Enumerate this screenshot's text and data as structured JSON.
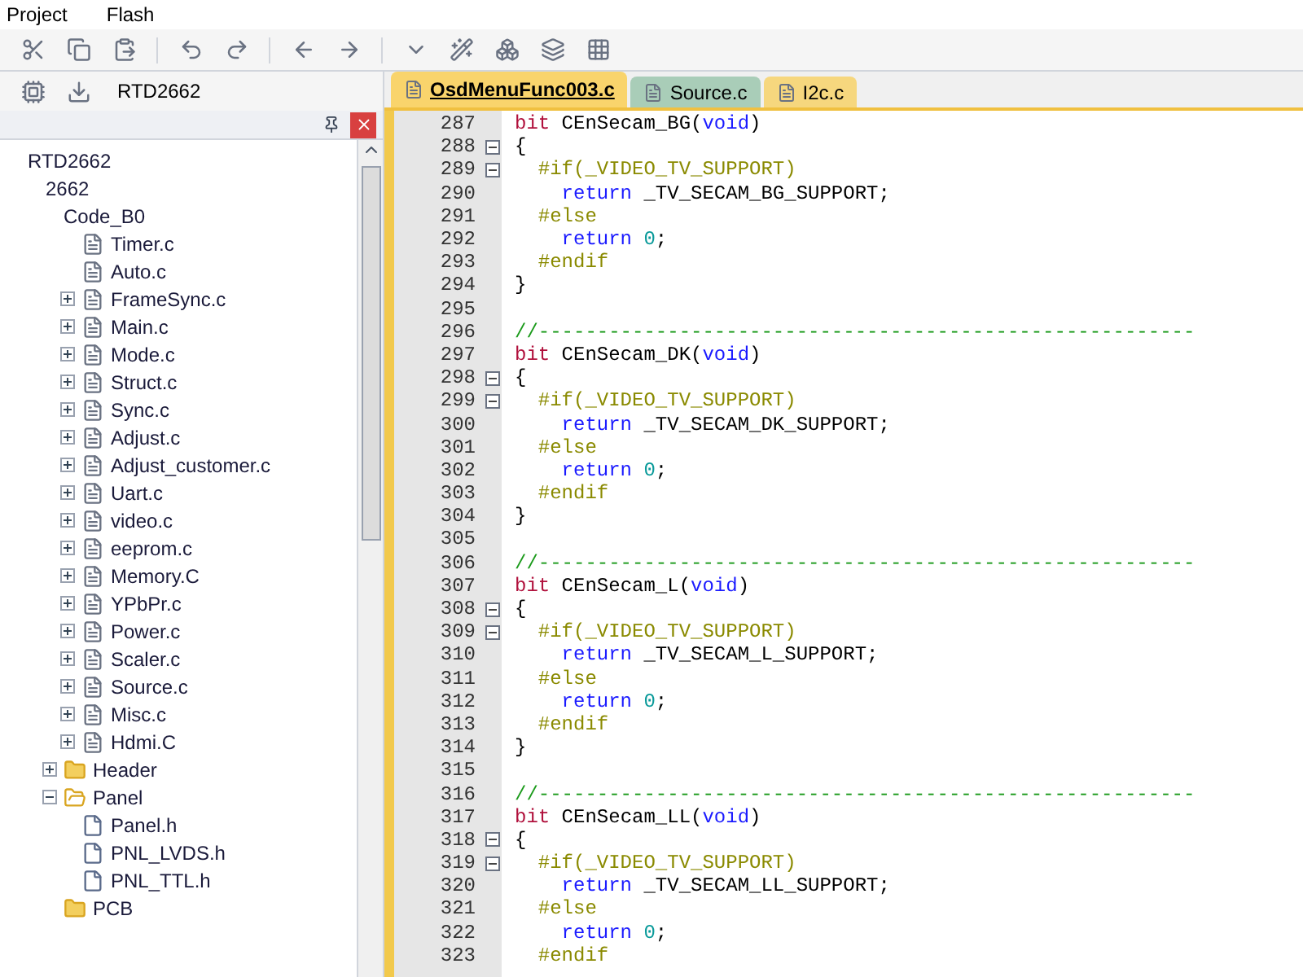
{
  "menu": [
    "Project",
    "Flash"
  ],
  "target": "RTD2662",
  "tabs": [
    {
      "label": "OsdMenuFunc003.c",
      "selected": true,
      "color": "#f9d46c"
    },
    {
      "label": "Source.c",
      "selected": false,
      "color": "#a9cdb8"
    },
    {
      "label": "I2c.c",
      "selected": false,
      "color": "#f6d77e"
    }
  ],
  "tree": [
    {
      "label": "RTD2662",
      "children": [
        {
          "label": "2662",
          "children": [
            {
              "label": "Code_B0",
              "children": [
                {
                  "label": "Timer.c",
                  "kind": "file"
                },
                {
                  "label": "Auto.c",
                  "kind": "file"
                },
                {
                  "label": "FrameSync.c",
                  "kind": "file",
                  "expanded": false
                },
                {
                  "label": "Main.c",
                  "kind": "file",
                  "expanded": false
                },
                {
                  "label": "Mode.c",
                  "kind": "file",
                  "expanded": false
                },
                {
                  "label": "Struct.c",
                  "kind": "file",
                  "expanded": false
                },
                {
                  "label": "Sync.c",
                  "kind": "file",
                  "expanded": false
                },
                {
                  "label": "Adjust.c",
                  "kind": "file",
                  "expanded": false
                },
                {
                  "label": "Adjust_customer.c",
                  "kind": "file",
                  "expanded": false
                },
                {
                  "label": "Uart.c",
                  "kind": "file",
                  "expanded": false
                },
                {
                  "label": "video.c",
                  "kind": "file",
                  "expanded": false
                },
                {
                  "label": "eeprom.c",
                  "kind": "file",
                  "expanded": false
                },
                {
                  "label": "Memory.C",
                  "kind": "file",
                  "expanded": false
                },
                {
                  "label": "YPbPr.c",
                  "kind": "file",
                  "expanded": false
                },
                {
                  "label": "Power.c",
                  "kind": "file",
                  "expanded": false
                },
                {
                  "label": "Scaler.c",
                  "kind": "file",
                  "expanded": false
                },
                {
                  "label": "Source.c",
                  "kind": "file",
                  "expanded": false
                },
                {
                  "label": "Misc.c",
                  "kind": "file",
                  "expanded": false
                },
                {
                  "label": "Hdmi.C",
                  "kind": "file",
                  "expanded": false
                }
              ]
            },
            {
              "label": "Header",
              "kind": "folder",
              "expanded": false
            },
            {
              "label": "Panel",
              "kind": "folder",
              "expanded": true,
              "children": [
                {
                  "label": "Panel.h",
                  "kind": "header"
                },
                {
                  "label": "PNL_LVDS.h",
                  "kind": "header"
                },
                {
                  "label": "PNL_TTL.h",
                  "kind": "header"
                }
              ]
            },
            {
              "label": "PCB",
              "kind": "folder"
            }
          ]
        }
      ]
    }
  ],
  "lines": [
    {
      "number": "287",
      "tokens": [
        {
          "kind": "type",
          "text": "bit"
        },
        {
          "kind": "plain",
          "text": " CEnSecam_BG("
        },
        {
          "kind": "keyword",
          "text": "void"
        },
        {
          "kind": "plain",
          "text": ")"
        }
      ]
    },
    {
      "number": "288",
      "fold": true,
      "tokens": [
        {
          "kind": "plain",
          "text": "{"
        }
      ]
    },
    {
      "number": "289",
      "fold": true,
      "tokens": [
        {
          "kind": "preproc",
          "text": "  #if(_VIDEO_TV_SUPPORT)"
        }
      ]
    },
    {
      "number": "290",
      "tokens": [
        {
          "kind": "keyword",
          "text": "    return"
        },
        {
          "kind": "plain",
          "text": " _TV_SECAM_BG_SUPPORT;"
        }
      ]
    },
    {
      "number": "291",
      "tokens": [
        {
          "kind": "preproc",
          "text": "  #else"
        }
      ]
    },
    {
      "number": "292",
      "tokens": [
        {
          "kind": "keyword",
          "text": "    return"
        },
        {
          "kind": "number",
          "text": " 0"
        },
        {
          "kind": "plain",
          "text": ";"
        }
      ]
    },
    {
      "number": "293",
      "tokens": [
        {
          "kind": "preproc",
          "text": "  #endif"
        }
      ]
    },
    {
      "number": "294",
      "tokens": [
        {
          "kind": "plain",
          "text": "}"
        }
      ]
    },
    {
      "number": "295"
    },
    {
      "number": "296",
      "tokens": [
        {
          "kind": "comment",
          "text": "//--------------------------------------------------------"
        }
      ]
    },
    {
      "number": "297",
      "tokens": [
        {
          "kind": "type",
          "text": "bit"
        },
        {
          "kind": "plain",
          "text": " CEnSecam_DK("
        },
        {
          "kind": "keyword",
          "text": "void"
        },
        {
          "kind": "plain",
          "text": ")"
        }
      ]
    },
    {
      "number": "298",
      "fold": true,
      "tokens": [
        {
          "kind": "plain",
          "text": "{"
        }
      ]
    },
    {
      "number": "299",
      "fold": true,
      "tokens": [
        {
          "kind": "preproc",
          "text": "  #if(_VIDEO_TV_SUPPORT)"
        }
      ]
    },
    {
      "number": "300",
      "tokens": [
        {
          "kind": "keyword",
          "text": "    return"
        },
        {
          "kind": "plain",
          "text": " _TV_SECAM_DK_SUPPORT;"
        }
      ]
    },
    {
      "number": "301",
      "tokens": [
        {
          "kind": "preproc",
          "text": "  #else"
        }
      ]
    },
    {
      "number": "302",
      "tokens": [
        {
          "kind": "keyword",
          "text": "    return"
        },
        {
          "kind": "number",
          "text": " 0"
        },
        {
          "kind": "plain",
          "text": ";"
        }
      ]
    },
    {
      "number": "303",
      "tokens": [
        {
          "kind": "preproc",
          "text": "  #endif"
        }
      ]
    },
    {
      "number": "304",
      "tokens": [
        {
          "kind": "plain",
          "text": "}"
        }
      ]
    },
    {
      "number": "305"
    },
    {
      "number": "306",
      "tokens": [
        {
          "kind": "comment",
          "text": "//--------------------------------------------------------"
        }
      ]
    },
    {
      "number": "307",
      "tokens": [
        {
          "kind": "type",
          "text": "bit"
        },
        {
          "kind": "plain",
          "text": " CEnSecam_L("
        },
        {
          "kind": "keyword",
          "text": "void"
        },
        {
          "kind": "plain",
          "text": ")"
        }
      ]
    },
    {
      "number": "308",
      "fold": true,
      "tokens": [
        {
          "kind": "plain",
          "text": "{"
        }
      ]
    },
    {
      "number": "309",
      "fold": true,
      "tokens": [
        {
          "kind": "preproc",
          "text": "  #if(_VIDEO_TV_SUPPORT)"
        }
      ]
    },
    {
      "number": "310",
      "tokens": [
        {
          "kind": "keyword",
          "text": "    return"
        },
        {
          "kind": "plain",
          "text": " _TV_SECAM_L_SUPPORT;"
        }
      ]
    },
    {
      "number": "311",
      "tokens": [
        {
          "kind": "preproc",
          "text": "  #else"
        }
      ]
    },
    {
      "number": "312",
      "tokens": [
        {
          "kind": "keyword",
          "text": "    return"
        },
        {
          "kind": "number",
          "text": " 0"
        },
        {
          "kind": "plain",
          "text": ";"
        }
      ]
    },
    {
      "number": "313",
      "tokens": [
        {
          "kind": "preproc",
          "text": "  #endif"
        }
      ]
    },
    {
      "number": "314",
      "tokens": [
        {
          "kind": "plain",
          "text": "}"
        }
      ]
    },
    {
      "number": "315"
    },
    {
      "number": "316",
      "tokens": [
        {
          "kind": "comment",
          "text": "//--------------------------------------------------------"
        }
      ]
    },
    {
      "number": "317",
      "tokens": [
        {
          "kind": "type",
          "text": "bit"
        },
        {
          "kind": "plain",
          "text": " CEnSecam_LL("
        },
        {
          "kind": "keyword",
          "text": "void"
        },
        {
          "kind": "plain",
          "text": ")"
        }
      ]
    },
    {
      "number": "318",
      "fold": true,
      "tokens": [
        {
          "kind": "plain",
          "text": "{"
        }
      ]
    },
    {
      "number": "319",
      "fold": true,
      "tokens": [
        {
          "kind": "preproc",
          "text": "  #if(_VIDEO_TV_SUPPORT)"
        }
      ]
    },
    {
      "number": "320",
      "tokens": [
        {
          "kind": "keyword",
          "text": "    return"
        },
        {
          "kind": "plain",
          "text": " _TV_SECAM_LL_SUPPORT;"
        }
      ]
    },
    {
      "number": "321",
      "tokens": [
        {
          "kind": "preproc",
          "text": "  #else"
        }
      ]
    },
    {
      "number": "322",
      "tokens": [
        {
          "kind": "keyword",
          "text": "    return"
        },
        {
          "kind": "number",
          "text": " 0"
        },
        {
          "kind": "plain",
          "text": ";"
        }
      ]
    },
    {
      "number": "323",
      "tokens": [
        {
          "kind": "preproc",
          "text": "  #endif"
        }
      ]
    }
  ]
}
